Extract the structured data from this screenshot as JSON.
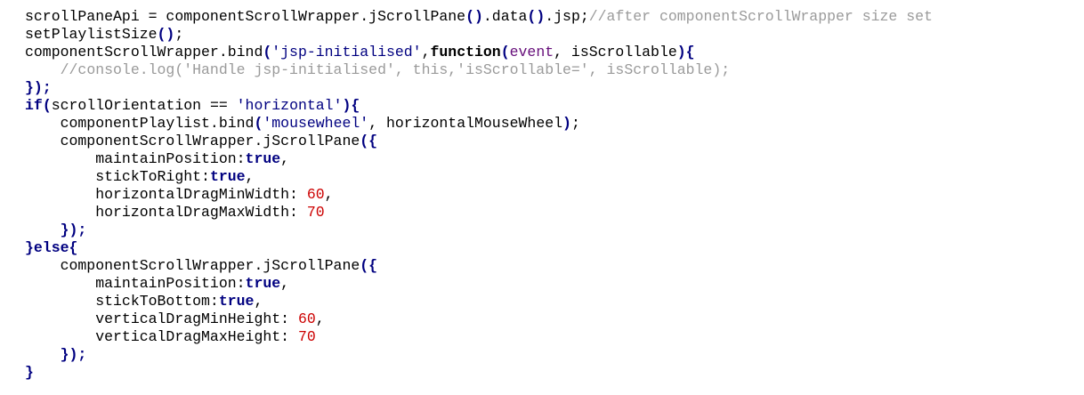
{
  "colors": {
    "background": "#ffffff",
    "plain": "#000000",
    "keyword": "#000080",
    "string": "#000080",
    "param": "#660e7a",
    "number": "#cc0000",
    "comment": "#9a9a9a"
  },
  "code_lines": [
    [
      [
        "plain",
        "scrollPaneApi = componentScrollWrapper.jScrollPane"
      ],
      [
        "paren",
        "()"
      ],
      [
        "plain",
        ".data"
      ],
      [
        "paren",
        "()"
      ],
      [
        "plain",
        ".jsp;"
      ],
      [
        "comment",
        "//after componentScrollWrapper size set"
      ]
    ],
    [
      [
        "plain",
        "setPlaylistSize"
      ],
      [
        "paren",
        "()"
      ],
      [
        "plain",
        ";"
      ]
    ],
    [
      [
        "plain",
        "componentScrollWrapper.bind"
      ],
      [
        "paren",
        "("
      ],
      [
        "string",
        "'jsp-initialised'"
      ],
      [
        "plain",
        ","
      ],
      [
        "fn",
        "function"
      ],
      [
        "paren",
        "("
      ],
      [
        "param",
        "event"
      ],
      [
        "plain",
        ", isScrollable"
      ],
      [
        "paren",
        ")"
      ],
      [
        "paren",
        "{"
      ]
    ],
    [
      [
        "plain",
        "    "
      ],
      [
        "comment",
        "//console.log('Handle jsp-initialised', this,'isScrollable=', isScrollable);"
      ]
    ],
    [
      [
        "paren",
        "});"
      ]
    ],
    [
      [
        "keyword",
        "if"
      ],
      [
        "paren",
        "("
      ],
      [
        "plain",
        "scrollOrientation == "
      ],
      [
        "string",
        "'horizontal'"
      ],
      [
        "paren",
        ")"
      ],
      [
        "paren",
        "{"
      ]
    ],
    [
      [
        "plain",
        "    componentPlaylist.bind"
      ],
      [
        "paren",
        "("
      ],
      [
        "string",
        "'mousewheel'"
      ],
      [
        "plain",
        ", horizontalMouseWheel"
      ],
      [
        "paren",
        ")"
      ],
      [
        "plain",
        ";"
      ]
    ],
    [
      [
        "plain",
        "    componentScrollWrapper.jScrollPane"
      ],
      [
        "paren",
        "({"
      ]
    ],
    [
      [
        "plain",
        "        maintainPosition:"
      ],
      [
        "keyword",
        "true"
      ],
      [
        "plain",
        ","
      ]
    ],
    [
      [
        "plain",
        "        stickToRight:"
      ],
      [
        "keyword",
        "true"
      ],
      [
        "plain",
        ","
      ]
    ],
    [
      [
        "plain",
        "        horizontalDragMinWidth: "
      ],
      [
        "number",
        "60"
      ],
      [
        "plain",
        ","
      ]
    ],
    [
      [
        "plain",
        "        horizontalDragMaxWidth: "
      ],
      [
        "number",
        "70"
      ]
    ],
    [
      [
        "plain",
        "    "
      ],
      [
        "paren",
        "});"
      ]
    ],
    [
      [
        "paren",
        "}"
      ],
      [
        "keyword",
        "else"
      ],
      [
        "paren",
        "{"
      ]
    ],
    [
      [
        "plain",
        "    componentScrollWrapper.jScrollPane"
      ],
      [
        "paren",
        "({"
      ]
    ],
    [
      [
        "plain",
        "        maintainPosition:"
      ],
      [
        "keyword",
        "true"
      ],
      [
        "plain",
        ","
      ]
    ],
    [
      [
        "plain",
        "        stickToBottom:"
      ],
      [
        "keyword",
        "true"
      ],
      [
        "plain",
        ","
      ]
    ],
    [
      [
        "plain",
        "        verticalDragMinHeight: "
      ],
      [
        "number",
        "60"
      ],
      [
        "plain",
        ","
      ]
    ],
    [
      [
        "plain",
        "        verticalDragMaxHeight: "
      ],
      [
        "number",
        "70"
      ]
    ],
    [
      [
        "plain",
        "    "
      ],
      [
        "paren",
        "});"
      ]
    ],
    [
      [
        "paren",
        "}"
      ]
    ]
  ]
}
